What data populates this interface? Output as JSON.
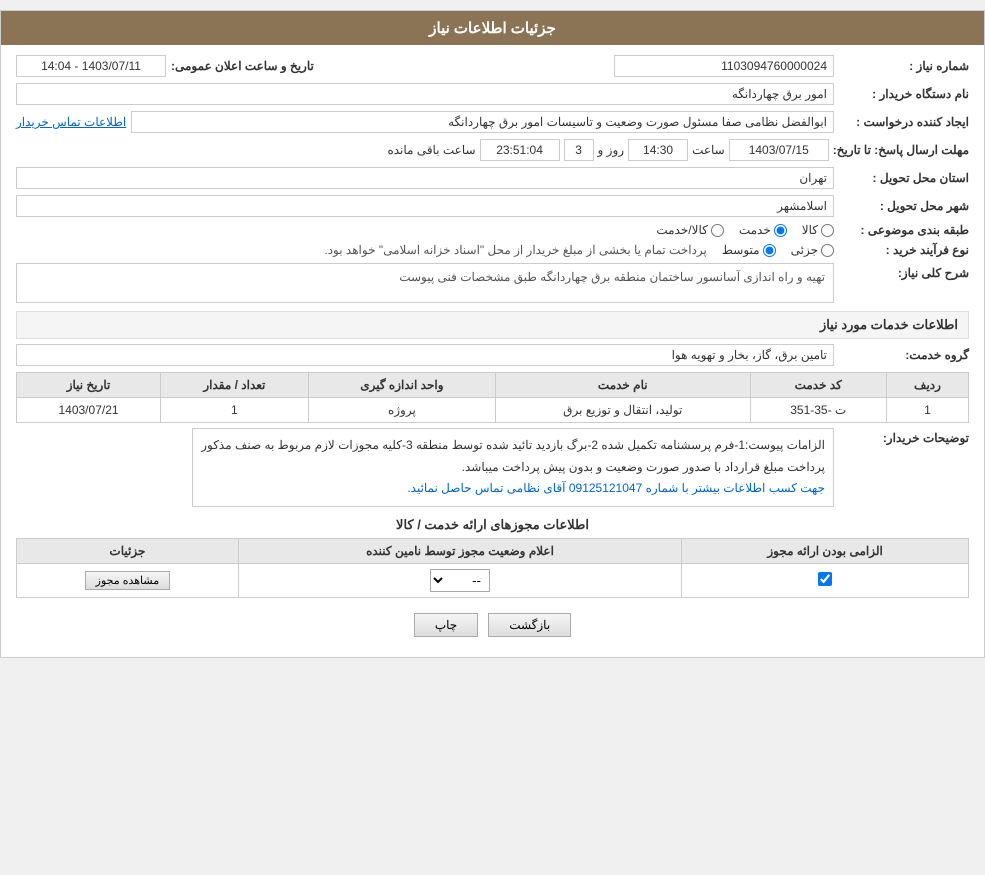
{
  "header": {
    "title": "جزئیات اطلاعات نیاز"
  },
  "fields": {
    "shomareNiaz_label": "شماره نیاز :",
    "shomareNiaz_value": "1103094760000024",
    "namDastgah_label": "نام دستگاه خریدار :",
    "namDastgah_value": "امور برق چهاردانگه",
    "ijadKonande_label": "ایجاد کننده درخواست :",
    "ijadKonande_value": "ابوالفضل نظامی صفا مسئول صورت وضعیت و تاسیسات امور برق چهاردانگه",
    "ijadKonande_link": "اطلاعات تماس خریدار",
    "mohlat_label": "مهلت ارسال پاسخ: تا تاریخ:",
    "date_value": "1403/07/15",
    "saat_label": "ساعت",
    "saat_value": "14:30",
    "rooz_label": "روز و",
    "rooz_value": "3",
    "countdown_value": "23:51:04",
    "baghimande_label": "ساعت باقی مانده",
    "ostan_label": "استان محل تحویل :",
    "ostan_value": "تهران",
    "shahr_label": "شهر محل تحویل :",
    "shahr_value": "اسلامشهر",
    "tabaghe_label": "طبقه بندی موضوعی :",
    "tabaghe_kala": "کالا",
    "tabaghe_khedmat": "خدمت",
    "tabaghe_kala_khedmat": "کالا/خدمت",
    "noeFarayand_label": "نوع فرآیند خرید :",
    "noeFarayand_jozee": "جزئی",
    "noeFarayand_motavasset": "متوسط",
    "noeFarayand_note": "پرداخت تمام یا بخشی از مبلغ خریدار از محل \"اسناد خزانه اسلامی\" خواهد بود.",
    "sharh_label": "شرح کلی نیاز:",
    "sharh_value": "تهیه و راه اندازی آسانسور ساختمان منطقه برق چهاردانگه طبق مشخصات فنی پیوست",
    "section_khadamat": "اطلاعات خدمات مورد نیاز",
    "grohe_label": "گروه خدمت:",
    "grohe_value": "تامین برق، گاز، بخار و تهویه هوا",
    "table_headers": {
      "radif": "ردیف",
      "kodKhedmat": "کد خدمت",
      "namKhedmat": "نام خدمت",
      "vahedAndaze": "واحد اندازه گیری",
      "tedad": "تعداد / مقدار",
      "tarikNiaz": "تاریخ نیاز"
    },
    "table_rows": [
      {
        "radif": "1",
        "kodKhedmat": "ت -35-351",
        "namKhedmat": "تولید، انتقال و توزیع برق",
        "vahedAndaze": "پروژه",
        "tedad": "1",
        "tarikNiaz": "1403/07/21"
      }
    ],
    "tosihKharidar_label": "توضیحات خریدار:",
    "tosihKharidar_line1": "الزامات پیوست:1-فرم پرسشنامه تکمیل شده 2-برگ بازدید تائید شده توسط منطقه 3-کلیه مجوزات لازم مربوط به صنف مذکور",
    "tosihKharidar_line2": "پرداخت مبلغ قرارداد با صدور صورت وضعیت و بدون پیش پرداخت میباشد.",
    "tosihKharidar_line3": "جهت کسب اطلاعات بیشتر با شماره 09125121047 آقای نظامی تماس حاصل نمائید.",
    "section_mojavez": "اطلاعات مجوزهای ارائه خدمت / کالا",
    "perm_table_headers": {
      "elzami": "الزامی بودن ارائه مجوز",
      "alam": "اعلام وضعیت مجوز توسط نامین کننده",
      "joziyat": "جزئیات"
    },
    "perm_row": {
      "elzami_checked": true,
      "alam_value": "--",
      "joziyat_btn": "مشاهده مجوز"
    },
    "btn_print": "چاپ",
    "btn_back": "بازگشت",
    "tarikAlan_label": "تاریخ و ساعت اعلان عمومی:",
    "tarikAlan_value": "1403/07/11 - 14:04"
  },
  "colors": {
    "header_bg": "#8B7355",
    "section_bg": "#f5f5f5"
  }
}
